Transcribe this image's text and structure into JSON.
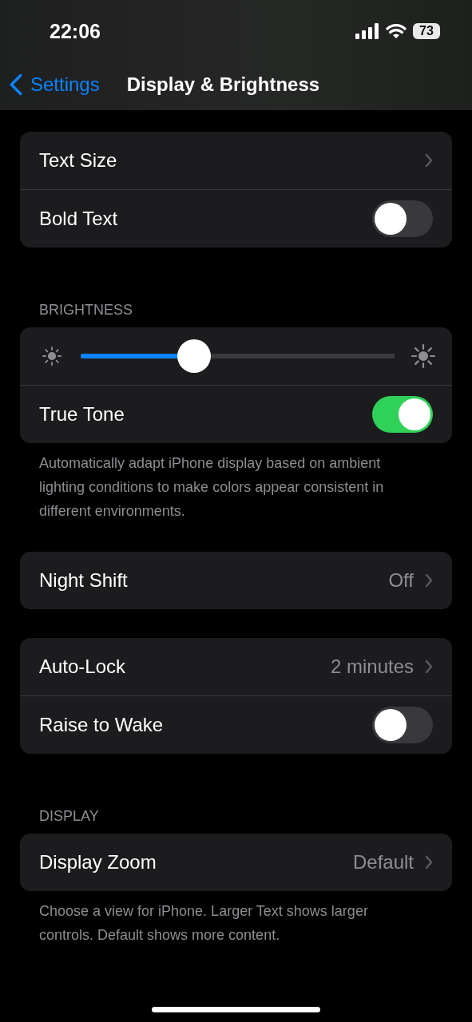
{
  "status_bar": {
    "time": "22:06",
    "battery": "73"
  },
  "nav": {
    "back": "Settings",
    "title": "Display & Brightness"
  },
  "sections": [
    {
      "rows": [
        {
          "kind": "link",
          "label": "Text Size"
        },
        {
          "kind": "toggle",
          "label": "Bold Text",
          "on": false
        }
      ]
    },
    {
      "header": "BRIGHTNESS",
      "rows": [
        {
          "kind": "slider",
          "level": 0.345
        },
        {
          "kind": "toggle",
          "label": "True Tone",
          "on": true
        }
      ],
      "footer": "Automatically adapt iPhone display based on ambient lighting conditions to make colors appear consistent in different environments."
    },
    {
      "rows": [
        {
          "kind": "link",
          "label": "Night Shift",
          "value": "Off"
        }
      ]
    },
    {
      "rows": [
        {
          "kind": "link",
          "label": "Auto-Lock",
          "value": "2 minutes"
        },
        {
          "kind": "toggle",
          "label": "Raise to Wake",
          "on": false
        }
      ]
    },
    {
      "header": "DISPLAY",
      "rows": [
        {
          "kind": "link",
          "label": "Display Zoom",
          "value": "Default"
        }
      ],
      "footer": "Choose a view for iPhone. Larger Text shows larger controls. Default shows more content."
    }
  ]
}
